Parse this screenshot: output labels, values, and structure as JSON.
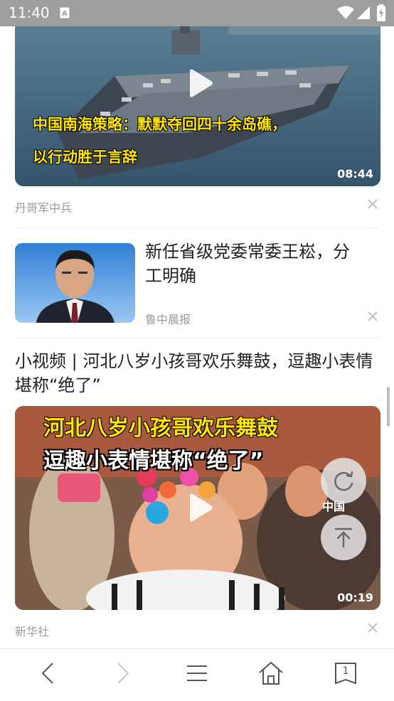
{
  "status_bar": {
    "time": "11:40",
    "icons": [
      "a-notification-icon",
      "wifi-icon",
      "signal-icon",
      "battery-icon"
    ]
  },
  "feed": {
    "items": [
      {
        "type": "video",
        "overlay_lines": [
          "中国南海策略：默默夺回四十余岛礁，",
          "以行动胜于言辞"
        ],
        "duration": "08:44",
        "source": "丹哥军中兵"
      },
      {
        "type": "article",
        "title": "新任省级党委常委王崧，分工明确",
        "source": "鲁中晨报"
      },
      {
        "type": "video",
        "title": "小视频 | 河北八岁小孩哥欢乐舞鼓，逗趣小表情堪称“绝了”",
        "overlay_lines": [
          "河北八岁小孩哥欢乐舞鼓",
          "逗趣小表情堪称“绝了”"
        ],
        "watermark": "中国",
        "duration": "00:19",
        "source": "新华社"
      }
    ]
  },
  "floating_buttons": [
    "refresh-icon",
    "back-to-top-icon"
  ],
  "bottom_nav": {
    "tab_count": "1",
    "icons": [
      "back-icon",
      "forward-icon",
      "menu-icon",
      "home-icon",
      "tabs-icon"
    ]
  },
  "colors": {
    "status_bar": "#9e9e9e",
    "overlay_text": "#ffe600",
    "secondary_text": "#9a9a9a"
  }
}
